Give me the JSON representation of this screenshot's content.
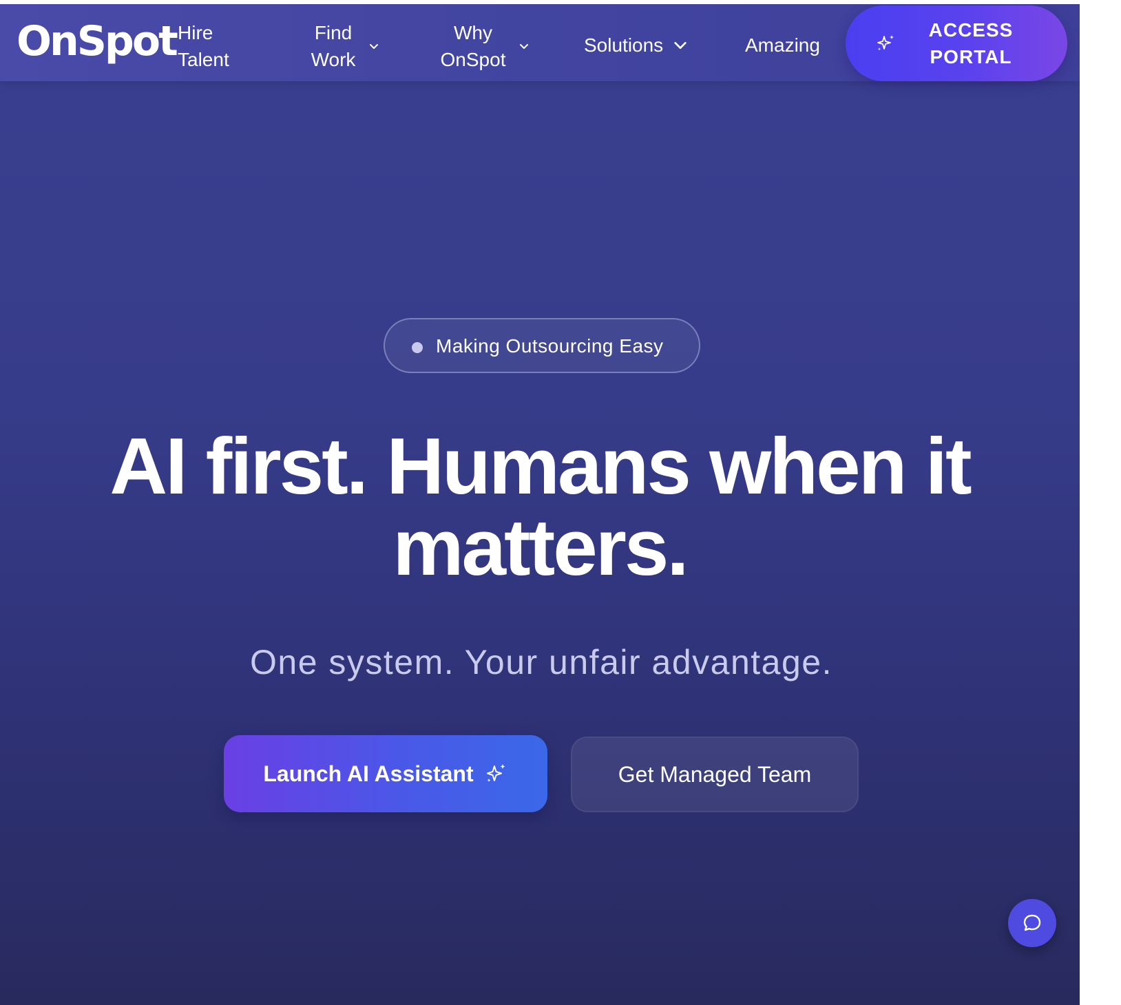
{
  "nav": {
    "logo": "OnSpot",
    "hire_talent": "Hire Talent",
    "find_work": "Find Work",
    "why_onspot": "Why OnSpot",
    "solutions": "Solutions",
    "amazing": "Amazing",
    "access_portal": "ACCESS PORTAL"
  },
  "hero": {
    "badge": "Making Outsourcing Easy",
    "headline_line1": "AI first. Humans when it",
    "headline_line2": "matters.",
    "subheadline": "One system. Your unfair advantage.",
    "primary_cta": "Launch AI Assistant",
    "secondary_cta": "Get Managed Team"
  },
  "icons": {
    "sparkle": "sparkle-icon",
    "chevron": "chevron-down-icon",
    "chat": "chat-bubble-icon"
  },
  "colors": {
    "background": "#373c8a",
    "nav": "#4245a0",
    "accent": "#5a42ee",
    "primary_cta_start": "#6a3fe4",
    "primary_cta_end": "#3a68e8"
  }
}
